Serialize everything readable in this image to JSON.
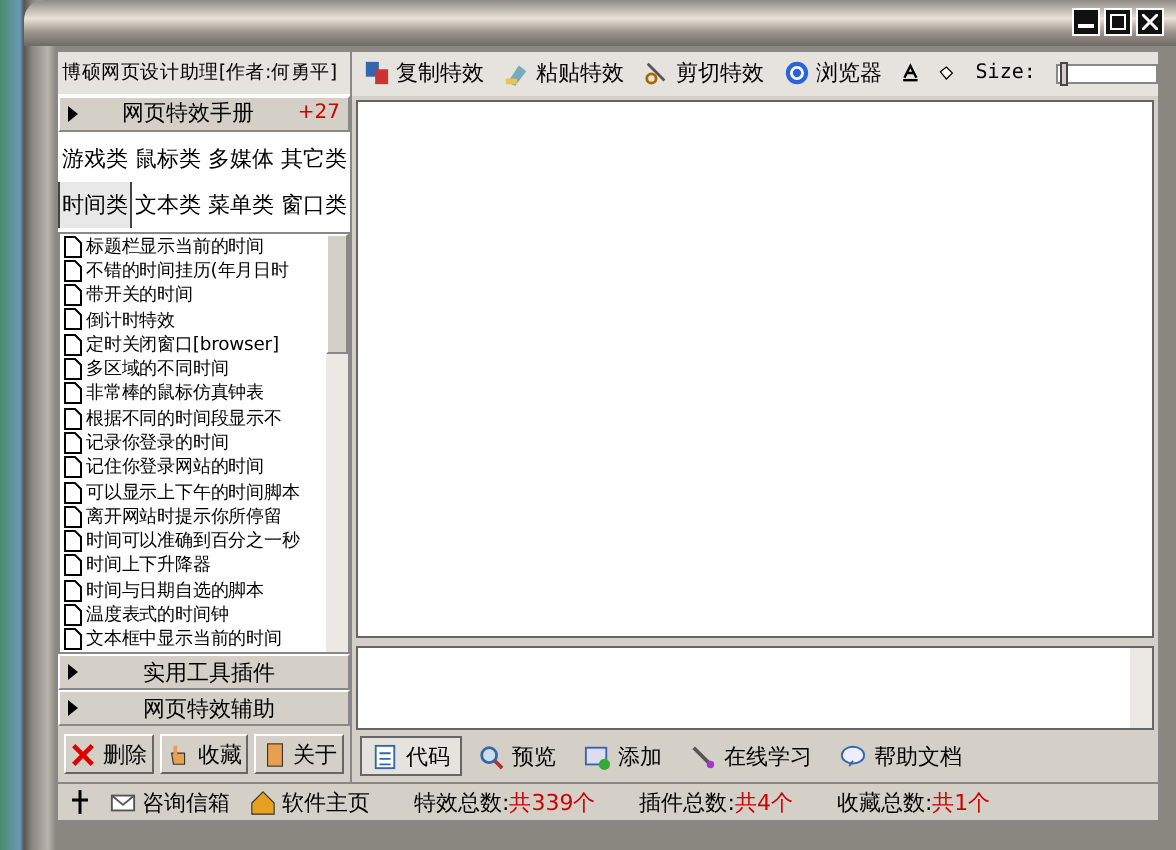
{
  "window": {
    "title": "博硕网页设计助理[作者:何勇平]"
  },
  "toolbar": [
    {
      "label": "复制特效"
    },
    {
      "label": "粘贴特效"
    },
    {
      "label": "剪切特效"
    },
    {
      "label": "浏览器"
    }
  ],
  "size": {
    "label": "Size:",
    "level": 0.02
  },
  "manual": {
    "title": "网页特效手册",
    "count": "+27"
  },
  "categories": [
    {
      "label": "游戏类",
      "selected": false
    },
    {
      "label": "鼠标类",
      "selected": false
    },
    {
      "label": "多媒体",
      "selected": false
    },
    {
      "label": "其它类",
      "selected": false
    },
    {
      "label": "时间类",
      "selected": true
    },
    {
      "label": "文本类",
      "selected": false
    },
    {
      "label": "菜单类",
      "selected": false
    },
    {
      "label": "窗口类",
      "selected": false
    }
  ],
  "effects": [
    "标题栏显示当前的时间",
    "不错的时间挂历(年月日时",
    "带开关的时间",
    "倒计时特效",
    "定时关闭窗口[browser]",
    "多区域的不同时间",
    "非常棒的鼠标仿真钟表",
    "根据不同的时间段显示不",
    "记录你登录的时间",
    "记住你登录网站的时间",
    "可以显示上下午的时间脚本",
    "离开网站时提示你所停留",
    "时间可以准确到百分之一秒",
    "时间上下升降器",
    "时间与日期自选的脚本",
    "温度表式的时间钟",
    "文本框中显示当前的时间"
  ],
  "sections": [
    "实用工具插件",
    "网页特效辅助"
  ],
  "actions": [
    {
      "label": "删除"
    },
    {
      "label": "收藏"
    },
    {
      "label": "关于"
    }
  ],
  "tabs": [
    {
      "label": "代码",
      "selected": true
    },
    {
      "label": "预览",
      "selected": false
    },
    {
      "label": "添加",
      "selected": false
    },
    {
      "label": "在线学习",
      "selected": false
    },
    {
      "label": "帮助文档",
      "selected": false
    }
  ],
  "status_bar": {
    "links": [
      {
        "label": "咨询信箱"
      },
      {
        "label": "软件主页"
      }
    ],
    "stats": [
      {
        "label": "特效总数:",
        "value": "共339个"
      },
      {
        "label": "插件总数:",
        "value": "共4个"
      },
      {
        "label": "收藏总数:",
        "value": "共1个"
      }
    ]
  }
}
